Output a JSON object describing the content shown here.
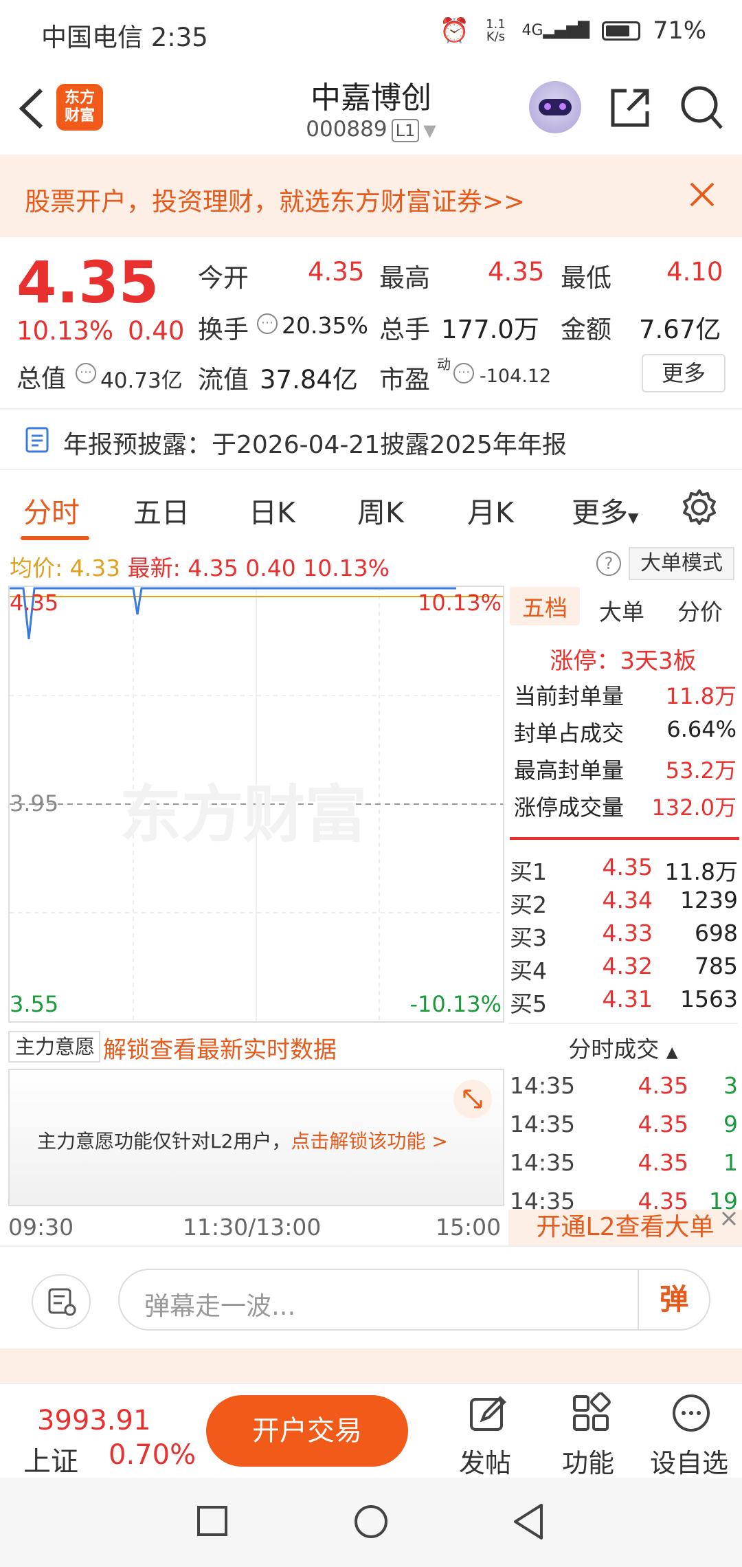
{
  "status": {
    "carrier": "中国电信 2:35",
    "net_speed": "1.1 K/s",
    "signal": "4G",
    "battery": "71%"
  },
  "header": {
    "title": "中嘉博创",
    "code": "000889",
    "level": "L1",
    "logo_text": "东方财富"
  },
  "banner": {
    "text": "股票开户，投资理财，就选东方财富证券>>"
  },
  "quote": {
    "price": "4.35",
    "change_pct": "10.13%",
    "change": "0.40",
    "open_label": "今开",
    "open": "4.35",
    "high_label": "最高",
    "high": "4.35",
    "low_label": "最低",
    "low": "4.10",
    "turnover_label": "换手",
    "turnover": "20.35%",
    "volume_label": "总手",
    "volume": "177.0万",
    "amount_label": "金额",
    "amount": "7.67亿",
    "mktcap_label": "总值",
    "mktcap": "40.73亿",
    "float_label": "流值",
    "float": "37.84亿",
    "pe_label": "市盈",
    "pe_sup": "动",
    "pe": "-104.12",
    "more": "更多"
  },
  "notice": {
    "text": "年报预披露：于2026-04-21披露2025年年报"
  },
  "tabs": [
    "分时",
    "五日",
    "日K",
    "周K",
    "月K",
    "更多"
  ],
  "avgline": {
    "avg_label": "均价:",
    "avg": "4.33",
    "latest_label": "最新:",
    "latest": "4.35",
    "change": "0.40",
    "pct": "10.13%"
  },
  "mode_btn": "大单模式",
  "chart": {
    "top_price": "4.35",
    "top_pct": "10.13%",
    "mid_price": "3.95",
    "bottom_price": "3.55",
    "bottom_pct": "-10.13%",
    "watermark": "东方财富"
  },
  "rpanel": {
    "tabs": [
      "五档",
      "大单",
      "分价"
    ],
    "limit_up": "涨停：3天3板",
    "stats": [
      {
        "label": "当前封单量",
        "value": "11.8万",
        "red": true
      },
      {
        "label": "封单占成交",
        "value": "6.64%",
        "red": false
      },
      {
        "label": "最高封单量",
        "value": "53.2万",
        "red": true
      },
      {
        "label": "涨停成交量",
        "value": "132.0万",
        "red": true
      }
    ],
    "orderbook": [
      {
        "label": "买1",
        "price": "4.35",
        "vol": "11.8万"
      },
      {
        "label": "买2",
        "price": "4.34",
        "vol": "1239"
      },
      {
        "label": "买3",
        "price": "4.33",
        "vol": "698"
      },
      {
        "label": "买4",
        "price": "4.32",
        "vol": "785"
      },
      {
        "label": "买5",
        "price": "4.31",
        "vol": "1563"
      }
    ],
    "trades_title": "分时成交",
    "trades": [
      {
        "time": "14:35",
        "price": "4.35",
        "vol": "3"
      },
      {
        "time": "14:35",
        "price": "4.35",
        "vol": "9"
      },
      {
        "time": "14:35",
        "price": "4.35",
        "vol": "1"
      },
      {
        "time": "14:35",
        "price": "4.35",
        "vol": "19"
      }
    ],
    "l2": "开通L2查看大单"
  },
  "zhuli": {
    "select": "主力意愿",
    "unlock": "解锁查看最新实时数据",
    "msg": "主力意愿功能仅针对L2用户，",
    "msg_link": "点击解锁该功能 >"
  },
  "times": [
    "09:30",
    "11:30/13:00",
    "15:00"
  ],
  "danmu": {
    "placeholder": "弹幕走一波...",
    "btn": "弹"
  },
  "bottom": {
    "index_value": "3993.91",
    "index_name": "上证",
    "index_pct": "0.70%",
    "trade_btn": "开户交易",
    "post": "发帖",
    "func": "功能",
    "watch": "设自选"
  }
}
